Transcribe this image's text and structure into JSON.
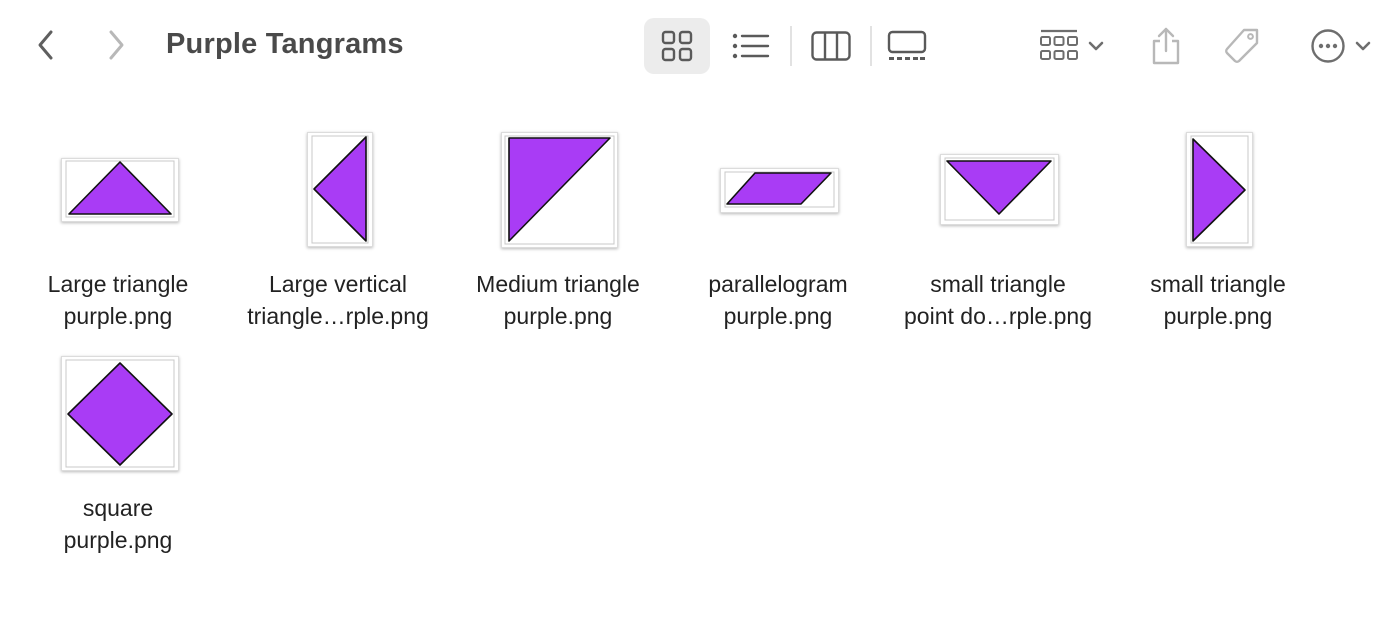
{
  "window": {
    "title": "Purple Tangrams"
  },
  "toolbar": {
    "back_icon": "chevron-left-icon",
    "forward_icon": "chevron-right-icon",
    "views": [
      {
        "name": "icon-view",
        "icon": "grid-icon",
        "active": true
      },
      {
        "name": "list-view",
        "icon": "list-icon",
        "active": false
      },
      {
        "name": "column-view",
        "icon": "columns-icon",
        "active": false
      },
      {
        "name": "gallery-view",
        "icon": "gallery-icon",
        "active": false
      }
    ],
    "group_icon": "group-by-icon",
    "share_icon": "share-icon",
    "tag_icon": "tag-icon",
    "more_icon": "ellipsis-circle-icon"
  },
  "colors": {
    "shape_fill": "#a93cf5",
    "shape_stroke": "#111111",
    "icon_gray": "#6e6e6e",
    "icon_light": "#b8b8b8"
  },
  "files": [
    {
      "line1": "Large triangle",
      "line2": "purple.png"
    },
    {
      "line1": "Large vertical",
      "line2": "triangle…rple.png"
    },
    {
      "line1": "Medium triangle",
      "line2": "purple.png"
    },
    {
      "line1": "parallelogram",
      "line2": "purple.png"
    },
    {
      "line1": "small triangle",
      "line2": "point do…rple.png"
    },
    {
      "line1": "small triangle",
      "line2": "purple.png"
    },
    {
      "line1": "square",
      "line2": "purple.png"
    }
  ]
}
